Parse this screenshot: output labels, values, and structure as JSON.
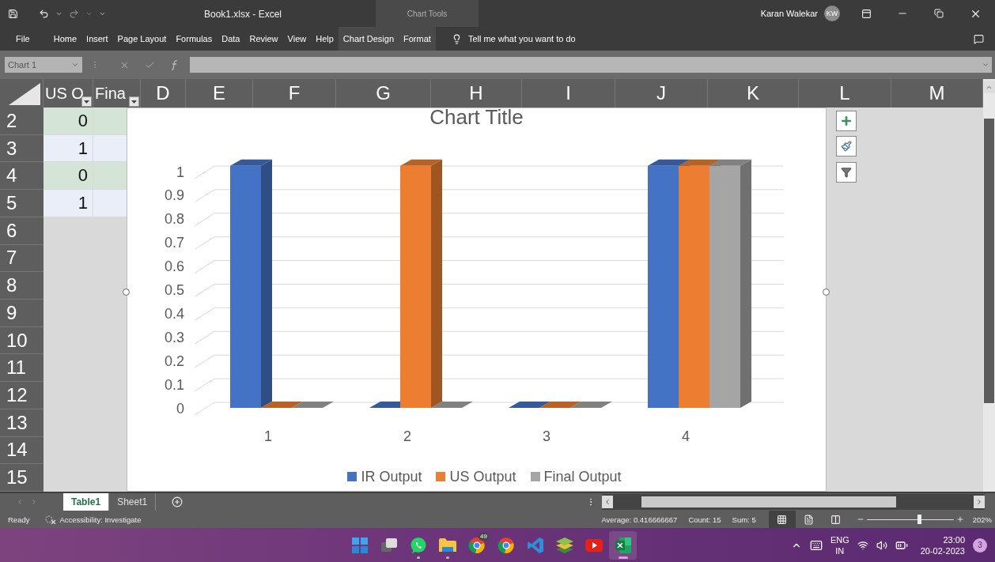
{
  "title_bar": {
    "title": "Book1.xlsx  -  Excel",
    "context_group": "Chart Tools",
    "user": "Karan Walekar",
    "avatar": "KW"
  },
  "menu": {
    "items": [
      {
        "label": "File",
        "contextual": false
      },
      {
        "label": "Home",
        "contextual": false
      },
      {
        "label": "Insert",
        "contextual": false
      },
      {
        "label": "Page Layout",
        "contextual": false
      },
      {
        "label": "Formulas",
        "contextual": false
      },
      {
        "label": "Data",
        "contextual": false
      },
      {
        "label": "Review",
        "contextual": false
      },
      {
        "label": "View",
        "contextual": false
      },
      {
        "label": "Help",
        "contextual": false
      },
      {
        "label": "Chart Design",
        "contextual": true
      },
      {
        "label": "Format",
        "contextual": true
      }
    ],
    "search_placeholder": "Tell me what you want to do"
  },
  "formula_bar": {
    "name_box": "Chart 1"
  },
  "sheet": {
    "columns": [
      {
        "label": "US O",
        "filter": true
      },
      {
        "label": "Fina",
        "filter": true
      },
      {
        "label": "D",
        "filter": false
      },
      {
        "label": "E",
        "filter": false
      },
      {
        "label": "F",
        "filter": false
      },
      {
        "label": "G",
        "filter": false
      },
      {
        "label": "H",
        "filter": false
      },
      {
        "label": "I",
        "filter": false
      },
      {
        "label": "J",
        "filter": false
      },
      {
        "label": "K",
        "filter": false
      },
      {
        "label": "L",
        "filter": false
      },
      {
        "label": "M",
        "filter": false
      }
    ],
    "rows": [
      {
        "number": "2",
        "cells": [
          "0"
        ]
      },
      {
        "number": "3",
        "cells": [
          "1"
        ]
      },
      {
        "number": "4",
        "cells": [
          "0"
        ]
      },
      {
        "number": "5",
        "cells": [
          "1"
        ]
      },
      {
        "number": "6"
      },
      {
        "number": "7"
      },
      {
        "number": "8"
      },
      {
        "number": "9"
      },
      {
        "number": "10"
      },
      {
        "number": "11"
      },
      {
        "number": "12"
      },
      {
        "number": "13"
      },
      {
        "number": "14"
      },
      {
        "number": "15"
      }
    ]
  },
  "chart": {
    "chart_data": {
      "type": "bar",
      "title": "Chart Title",
      "categories": [
        "1",
        "2",
        "3",
        "4"
      ],
      "series": [
        {
          "name": "IR Output",
          "color": "#4472c4",
          "values": [
            1,
            0,
            0,
            1
          ]
        },
        {
          "name": "US Output",
          "color": "#ed7d31",
          "values": [
            0,
            1,
            0,
            1
          ]
        },
        {
          "name": "Final Output",
          "color": "#a5a5a5",
          "values": [
            0,
            0,
            0,
            1
          ]
        }
      ],
      "ylim": [
        0,
        1
      ],
      "yticks": [
        0,
        0.1,
        0.2,
        0.3,
        0.4,
        0.5,
        0.6,
        0.7,
        0.8,
        0.9,
        1
      ]
    }
  },
  "sheet_tabs": [
    {
      "label": "Table1",
      "selected": true
    },
    {
      "label": "Sheet1",
      "selected": false
    }
  ],
  "status_bar": {
    "ready": "Ready",
    "accessibility": "Accessibility: Investigate",
    "average": "Average: 0.416666667",
    "count": "Count: 15",
    "sum": "Sum: 5",
    "views": [
      {
        "kind": "normal",
        "selected": true
      },
      {
        "kind": "page-layout",
        "selected": false
      },
      {
        "kind": "page-break",
        "selected": false
      }
    ],
    "zoom_slider": {
      "level": 0.6
    },
    "zoom": "202%"
  },
  "taskbar": {
    "apps": [
      {
        "kind": "start",
        "running": false,
        "selected": false
      },
      {
        "kind": "task-view",
        "running": false,
        "selected": false
      },
      {
        "kind": "chat",
        "running": true,
        "selected": false
      },
      {
        "kind": "folder",
        "running": true,
        "selected": false
      },
      {
        "kind": "browser",
        "badge": "49",
        "running": false,
        "selected": false
      },
      {
        "kind": "browser",
        "running": false,
        "selected": false
      },
      {
        "kind": "code",
        "running": false,
        "selected": false
      },
      {
        "kind": "layers",
        "running": false,
        "selected": false
      },
      {
        "kind": "video",
        "running": false,
        "selected": false
      },
      {
        "kind": "sheet",
        "running": true,
        "selected": true
      }
    ],
    "language": [
      "ENG",
      "IN"
    ],
    "time": "23:00",
    "date": "20-02-2023",
    "notifications": "3"
  }
}
